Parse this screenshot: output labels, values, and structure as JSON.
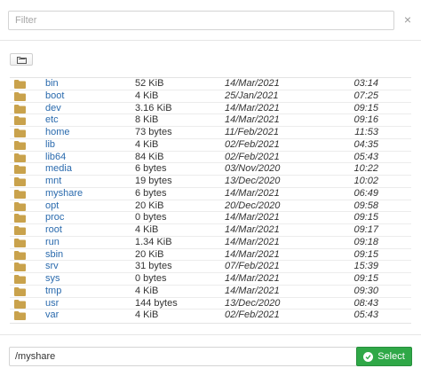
{
  "filter": {
    "placeholder": "Filter",
    "value": "",
    "clear_glyph": "×"
  },
  "toolbar": {
    "new_folder_icon": "new-folder-icon"
  },
  "folder_color": "#c9a24c",
  "files": [
    {
      "name": "bin",
      "size": "52 KiB",
      "date": "14/Mar/2021",
      "time": "03:14"
    },
    {
      "name": "boot",
      "size": "4 KiB",
      "date": "25/Jan/2021",
      "time": "07:25"
    },
    {
      "name": "dev",
      "size": "3.16 KiB",
      "date": "14/Mar/2021",
      "time": "09:15"
    },
    {
      "name": "etc",
      "size": "8 KiB",
      "date": "14/Mar/2021",
      "time": "09:16"
    },
    {
      "name": "home",
      "size": "73 bytes",
      "date": "11/Feb/2021",
      "time": "11:53"
    },
    {
      "name": "lib",
      "size": "4 KiB",
      "date": "02/Feb/2021",
      "time": "04:35"
    },
    {
      "name": "lib64",
      "size": "84 KiB",
      "date": "02/Feb/2021",
      "time": "05:43"
    },
    {
      "name": "media",
      "size": "6 bytes",
      "date": "03/Nov/2020",
      "time": "10:22"
    },
    {
      "name": "mnt",
      "size": "19 bytes",
      "date": "13/Dec/2020",
      "time": "10:02"
    },
    {
      "name": "myshare",
      "size": "6 bytes",
      "date": "14/Mar/2021",
      "time": "06:49"
    },
    {
      "name": "opt",
      "size": "20 KiB",
      "date": "20/Dec/2020",
      "time": "09:58"
    },
    {
      "name": "proc",
      "size": "0 bytes",
      "date": "14/Mar/2021",
      "time": "09:15"
    },
    {
      "name": "root",
      "size": "4 KiB",
      "date": "14/Mar/2021",
      "time": "09:17"
    },
    {
      "name": "run",
      "size": "1.34 KiB",
      "date": "14/Mar/2021",
      "time": "09:18"
    },
    {
      "name": "sbin",
      "size": "20 KiB",
      "date": "14/Mar/2021",
      "time": "09:15"
    },
    {
      "name": "srv",
      "size": "31 bytes",
      "date": "07/Feb/2021",
      "time": "15:39"
    },
    {
      "name": "sys",
      "size": "0 bytes",
      "date": "14/Mar/2021",
      "time": "09:15"
    },
    {
      "name": "tmp",
      "size": "4 KiB",
      "date": "14/Mar/2021",
      "time": "09:30"
    },
    {
      "name": "usr",
      "size": "144 bytes",
      "date": "13/Dec/2020",
      "time": "08:43"
    },
    {
      "name": "var",
      "size": "4 KiB",
      "date": "02/Feb/2021",
      "time": "05:43"
    }
  ],
  "footer": {
    "path_value": "/myshare",
    "select_label": "Select",
    "select_color": "#2fa847"
  }
}
